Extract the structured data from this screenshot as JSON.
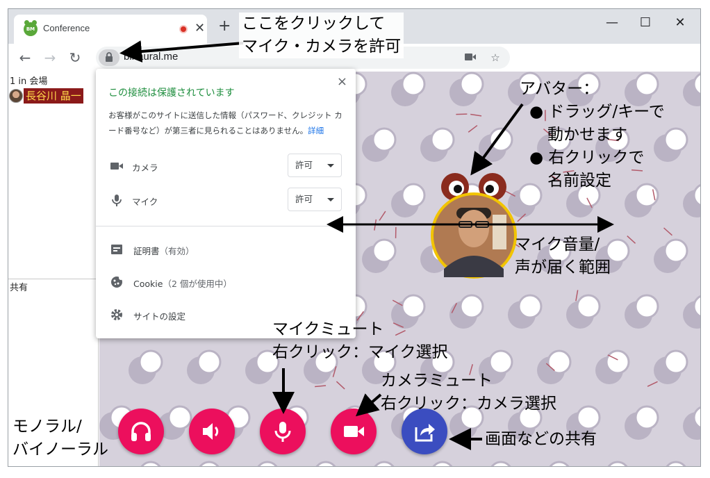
{
  "browser": {
    "tab_title": "Conference",
    "tab_favicon_text": "BM",
    "new_tab": "+",
    "url": "binaural.me",
    "win_minimize": "—",
    "win_maximize": "☐",
    "win_close": "✕"
  },
  "sidebar": {
    "count": "1 in 会場",
    "users": [
      {
        "name": "長谷川 晶一"
      }
    ],
    "share_label": "共有"
  },
  "popup": {
    "title": "この接続は保護されています",
    "description": "お客様がこのサイトに送信した情報（パスワード、クレジット カード番号など）が第三者に見られることはありません。",
    "link": "詳細",
    "close": "×",
    "permissions": [
      {
        "icon": "camera-icon",
        "label": "カメラ",
        "value": "許可"
      },
      {
        "icon": "microphone-icon",
        "label": "マイク",
        "value": "許可"
      }
    ],
    "items": [
      {
        "icon": "certificate-icon",
        "label": "証明書",
        "sub": "（有効）"
      },
      {
        "icon": "cookie-icon",
        "label": "Cookie",
        "sub": "（2 個が使用中）"
      },
      {
        "icon": "gear-icon",
        "label": "サイトの設定",
        "sub": ""
      }
    ]
  },
  "controls": [
    {
      "icon": "headphones-icon"
    },
    {
      "icon": "speaker-icon"
    },
    {
      "icon": "microphone-icon"
    },
    {
      "icon": "video-camera-icon"
    },
    {
      "icon": "share-icon"
    }
  ],
  "annotations": {
    "click_here_1": "ここをクリックして",
    "click_here_2": "マイク・カメラを許可",
    "avatar_title": "アバター：",
    "avatar_b1_1": "● ドラッグ/キーで",
    "avatar_b1_2": "動かせます",
    "avatar_b2_1": "● 右クリックで",
    "avatar_b2_2": "名前設定",
    "volume_1": "マイク音量/",
    "volume_2": "声が届く範囲",
    "mic_mute_1": "マイクミュート",
    "mic_mute_2": "右クリック：マイク選択",
    "cam_mute_1": "カメラミュート",
    "cam_mute_2": "右クリック：カメラ選択",
    "mono_1": "モノラル/",
    "mono_2": "バイノーラル",
    "share": "画面などの共有"
  },
  "colors": {
    "control_button": "#ec0f5d",
    "share_button": "#3b4dc0",
    "secure_text": "#1e8e3e",
    "room_background": "#d6d1dc",
    "user_highlight": "#8b1a1a",
    "avatar_ring": "#f2c400"
  }
}
